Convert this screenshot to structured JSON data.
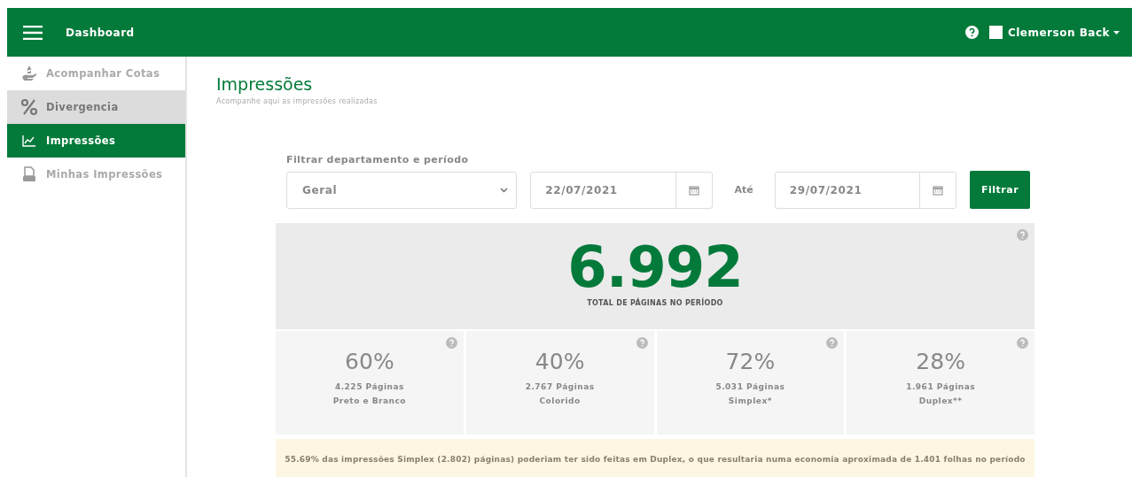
{
  "header": {
    "title": "Dashboard",
    "user": "Clemerson Back"
  },
  "sidebar": {
    "items": [
      {
        "label": "Acompanhar Cotas",
        "kind": "money",
        "selected": false,
        "highlighted": false
      },
      {
        "label": "Divergencia",
        "kind": "percent",
        "selected": false,
        "highlighted": true
      },
      {
        "label": "Impressões",
        "kind": "chart",
        "selected": true,
        "highlighted": false
      },
      {
        "label": "Minhas Impressões",
        "kind": "printer",
        "selected": false,
        "highlighted": false
      }
    ]
  },
  "page": {
    "title": "Impressões",
    "subtitle": "Acompanhe  aqui as impressões realizadas"
  },
  "filter": {
    "label": "Filtrar departamento e período",
    "department": "Geral",
    "start": "22/07/2021",
    "until": "Até",
    "end": "29/07/2021",
    "button": "Filtrar"
  },
  "total": {
    "value": "6.992",
    "caption": "TOTAL DE PÁGINAS NO PERÍODO"
  },
  "cards": [
    {
      "percent": "60%",
      "pages": "4.225 Páginas",
      "label": "Preto e Branco"
    },
    {
      "percent": "40%",
      "pages": "2.767 Páginas",
      "label": "Colorido"
    },
    {
      "percent": "72%",
      "pages": "5.031 Páginas",
      "label": "Simplex*"
    },
    {
      "percent": "28%",
      "pages": "1.961 Páginas",
      "label": "Duplex**"
    }
  ],
  "notice": "55.69% das impressões Simplex (2.802) páginas) poderiam ter sido feitas em Duplex, o que resultaria numa economia aproximada de 1.401 folhas no período"
}
